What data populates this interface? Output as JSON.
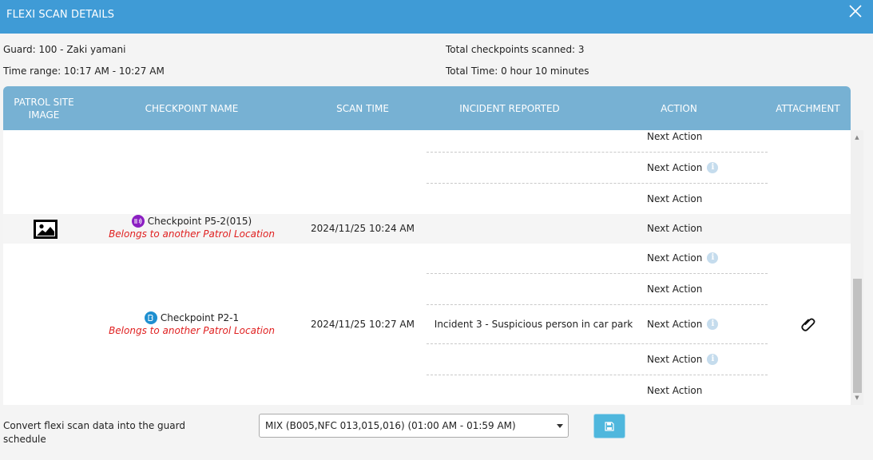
{
  "dialog": {
    "title": "FLEXI SCAN DETAILS"
  },
  "summary": {
    "guard": "Guard: 100 - Zaki yamani",
    "time_range": "Time range: 10:17 AM - 10:27 AM",
    "total_checkpoints": "Total checkpoints scanned: 3",
    "total_time": "Total Time: 0 hour 10 minutes"
  },
  "table": {
    "headers": {
      "patrol_site_image_line1": "PATROL SITE",
      "patrol_site_image_line2": "IMAGE",
      "checkpoint_name": "CHECKPOINT NAME",
      "scan_time": "SCAN TIME",
      "incident_reported": "INCIDENT REPORTED",
      "action": "ACTION",
      "attachment": "ATTACHMENT"
    },
    "next_action_label": "Next Action",
    "top_group_actions": [
      {
        "label": "Next Action",
        "info": false
      },
      {
        "label": "Next Action",
        "info": true
      },
      {
        "label": "Next Action",
        "info": false
      }
    ],
    "row_p5": {
      "checkpoint": "Checkpoint P5-2(015)",
      "badge": "nfc-icon",
      "badge_color": "#8b1fc2",
      "belongs": "Belongs to another Patrol Location",
      "scan_time": "2024/11/25 10:24 AM",
      "action": "Next Action"
    },
    "row_p2": {
      "checkpoint": "Checkpoint P2-1",
      "badge": "beacon-icon",
      "badge_color": "#1e8fd0",
      "belongs": "Belongs to another Patrol Location",
      "scan_time": "2024/11/25 10:27 AM",
      "actions": [
        {
          "label": "Next Action",
          "info": true
        },
        {
          "label": "Next Action",
          "info": false
        },
        {
          "label": "Next Action",
          "info": true,
          "incident": "Incident 3 - Suspicious person in car park",
          "attachment": "paperclip-icon"
        },
        {
          "label": "Next Action",
          "info": true
        },
        {
          "label": "Next Action",
          "info": false
        }
      ]
    }
  },
  "footer": {
    "convert_label": "Convert flexi scan data into the guard schedule",
    "schedule_select_value": "MIX (B005,NFC 013,015,016) (01:00 AM - 01:59 AM)",
    "save_icon": "floppy-disk-icon"
  },
  "colors": {
    "header_bar": "#3f9bd6",
    "table_header": "#77b1d3",
    "belongs_text": "#e02020",
    "save_button": "#4fb7dd"
  }
}
